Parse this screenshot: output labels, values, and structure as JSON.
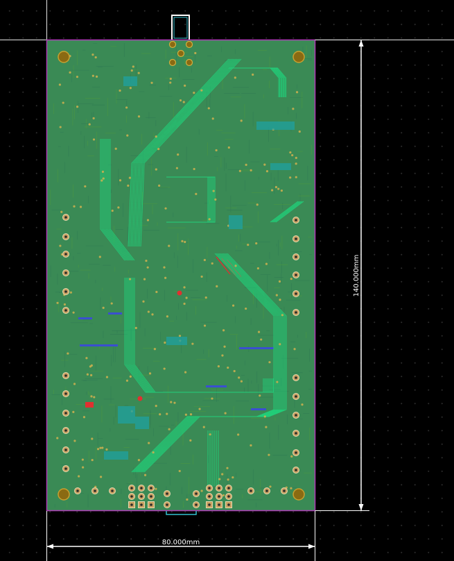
{
  "board": {
    "substrate_color": "#3a8a55",
    "outline_color": "#b03ab8",
    "trace_color": "#21d07a",
    "via_color": "#d0b050",
    "bus_color": "#3a4fd0",
    "hot_color": "#e03030"
  },
  "dimensions": {
    "width_label": "80.000mm",
    "height_label": "140.000mm",
    "line_color": "#ffffff"
  }
}
